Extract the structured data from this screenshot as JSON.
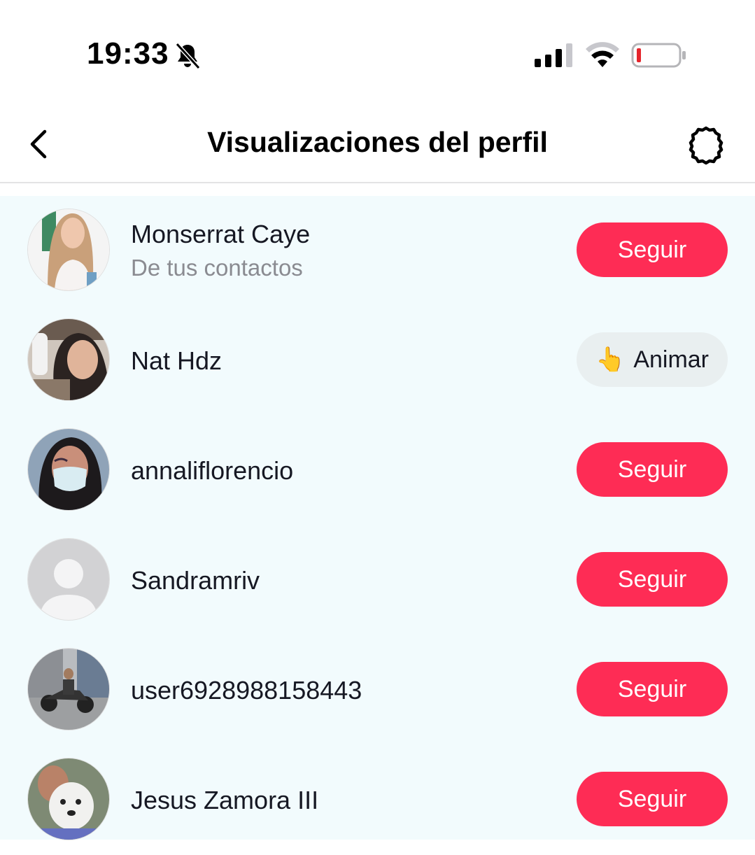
{
  "status_bar": {
    "time": "19:33",
    "icons": [
      "bell-muted-icon",
      "cellular-signal-icon",
      "wifi-icon",
      "battery-low-icon"
    ],
    "battery_color": "#e5252c"
  },
  "header": {
    "title": "Visualizaciones del perfil",
    "back_icon": "chevron-left-icon",
    "settings_icon": "gear-icon"
  },
  "colors": {
    "follow": "#fe2c55",
    "list_bg": "#f2fbfd",
    "animar_bg": "#e9eff0"
  },
  "viewers": [
    {
      "name": "Monserrat Caye",
      "subtitle": "De tus contactos",
      "action": "Seguir"
    },
    {
      "name": "Nat Hdz",
      "action": "Animar",
      "action_emoji": "👆"
    },
    {
      "name": "annaliflorencio",
      "action": "Seguir"
    },
    {
      "name": "Sandramriv",
      "action": "Seguir"
    },
    {
      "name": "user6928988158443",
      "action": "Seguir"
    },
    {
      "name": "Jesus Zamora III",
      "action": "Seguir"
    }
  ]
}
